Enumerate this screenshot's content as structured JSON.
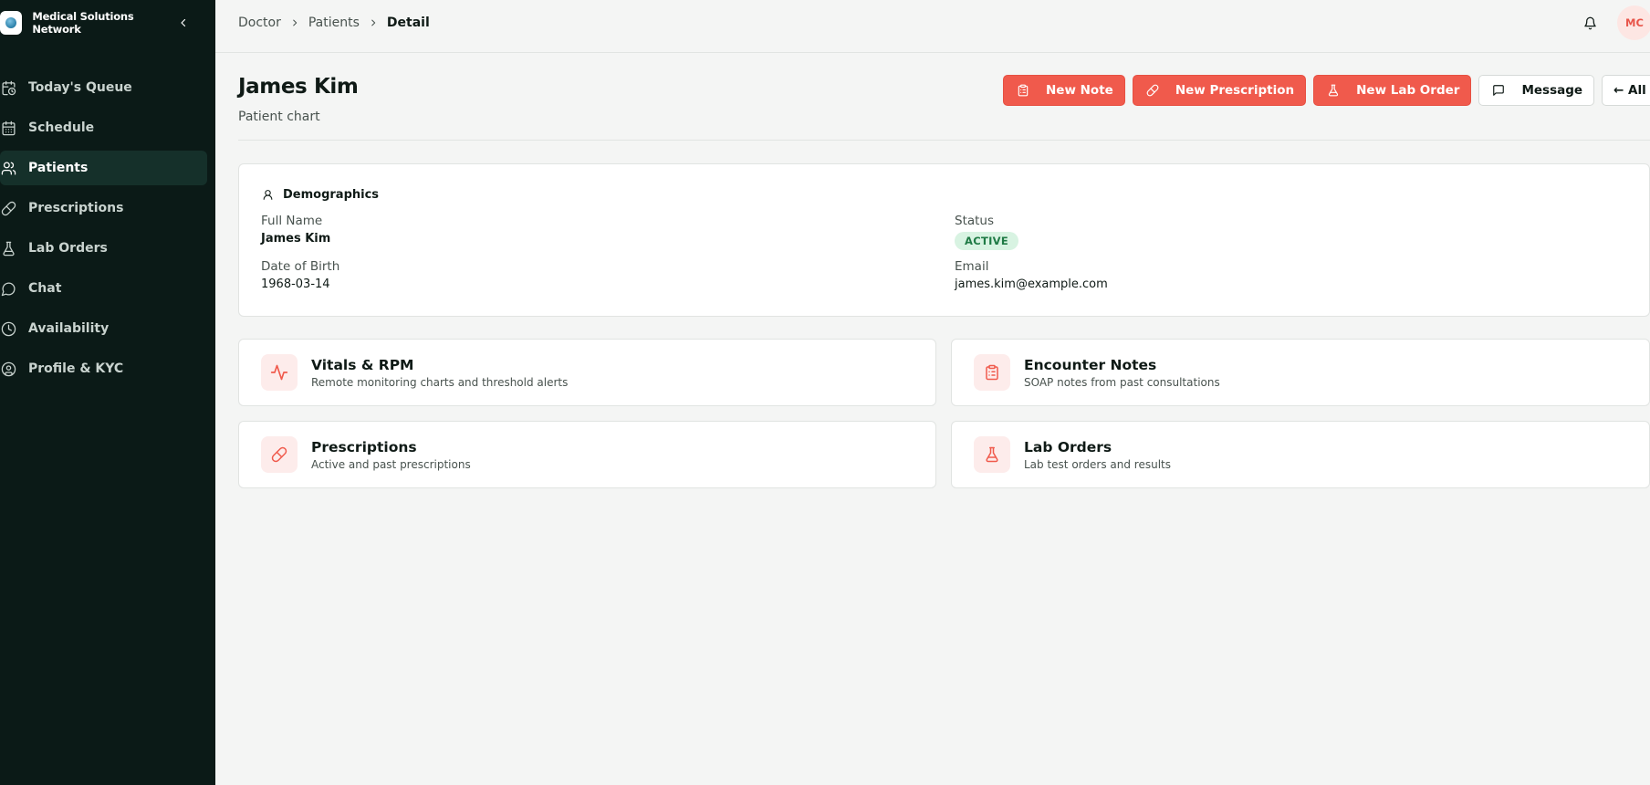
{
  "app": {
    "brand_name": "Medical Solutions Network",
    "accent_color": "#f05a4c",
    "sidebar_bg": "#0b1a17"
  },
  "sidebar": {
    "items": [
      {
        "label": "Today's Queue",
        "icon": "calendar-clock-icon",
        "active": false
      },
      {
        "label": "Schedule",
        "icon": "calendar-icon",
        "active": false
      },
      {
        "label": "Patients",
        "icon": "users-icon",
        "active": true
      },
      {
        "label": "Prescriptions",
        "icon": "pill-icon",
        "active": false
      },
      {
        "label": "Lab Orders",
        "icon": "flask-icon",
        "active": false
      },
      {
        "label": "Chat",
        "icon": "chat-bubble-icon",
        "active": false
      },
      {
        "label": "Availability",
        "icon": "clock-icon",
        "active": false
      },
      {
        "label": "Profile & KYC",
        "icon": "user-circle-icon",
        "active": false
      }
    ]
  },
  "breadcrumb": [
    "Doctor",
    "Patients",
    "Detail"
  ],
  "topbar": {
    "avatar_initials": "MC"
  },
  "header": {
    "title": "James Kim",
    "subtitle": "Patient chart"
  },
  "actions": [
    {
      "label": "New Note",
      "icon": "clipboard-icon",
      "style": "primary"
    },
    {
      "label": "New Prescription",
      "icon": "pill-icon",
      "style": "primary"
    },
    {
      "label": "New Lab Order",
      "icon": "flask-icon",
      "style": "primary"
    },
    {
      "label": "Message",
      "icon": "chat-bubble-icon",
      "style": "outline"
    },
    {
      "label": "← All Patients",
      "icon": "",
      "style": "outline"
    }
  ],
  "demographics": {
    "title": "Demographics",
    "full_name_label": "Full Name",
    "full_name": "James Kim",
    "dob_label": "Date of Birth",
    "dob": "1968-03-14",
    "status_label": "Status",
    "status": "ACTIVE",
    "email_label": "Email",
    "email": "james.kim@example.com"
  },
  "tiles": [
    {
      "title": "Vitals & RPM",
      "desc": "Remote monitoring charts and threshold alerts",
      "icon": "activity-icon"
    },
    {
      "title": "Encounter Notes",
      "desc": "SOAP notes from past consultations",
      "icon": "clipboard-icon"
    },
    {
      "title": "Prescriptions",
      "desc": "Active and past prescriptions",
      "icon": "pill-icon"
    },
    {
      "title": "Lab Orders",
      "desc": "Lab test orders and results",
      "icon": "flask-icon"
    }
  ]
}
